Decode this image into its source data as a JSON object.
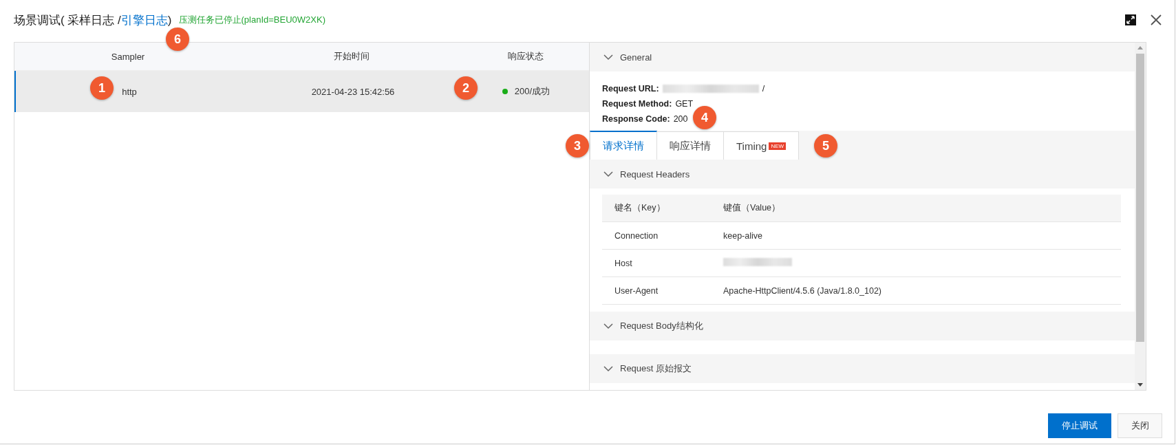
{
  "dialog": {
    "title_prefix": "场景调试( 采样日志 /",
    "title_link": "引擎日志",
    "title_suffix": ")",
    "status": "压测任务已停止(planId=BEU0W2XK)"
  },
  "samples": {
    "columns": [
      "Sampler",
      "开始时间",
      "响应状态"
    ],
    "rows": [
      {
        "sampler": "http",
        "start_time": "2021-04-23 15:42:56",
        "status": "200/成功",
        "color": "#1aad19",
        "selected": true
      }
    ]
  },
  "detail": {
    "general": {
      "title": "General",
      "expanded": true,
      "request_url_label": "Request URL:",
      "request_url_suffix": "/",
      "method_label": "Request Method:",
      "method": "GET",
      "code_label": "Response Code:",
      "code": "200"
    },
    "tabs": [
      {
        "label": "请求详情",
        "selected": true
      },
      {
        "label": "响应详情",
        "selected": false
      },
      {
        "label": "Timing",
        "badge": "NEW",
        "selected": false
      }
    ],
    "sections": [
      {
        "title": "Request Headers",
        "expanded": true,
        "columns": [
          "键名（Key）",
          "键值（Value）"
        ],
        "rows": [
          {
            "key": "Connection",
            "value": "keep-alive"
          },
          {
            "key": "Host",
            "redacted": true
          },
          {
            "key": "User-Agent",
            "value": "Apache-HttpClient/4.5.6 (Java/1.8.0_102)"
          }
        ]
      },
      {
        "title": "Request Body结构化",
        "expanded": true
      },
      {
        "title": "Request 原始报文",
        "expanded": true
      }
    ]
  },
  "buttons": [
    {
      "label": "停止调试",
      "kind": "primary"
    },
    {
      "label": "关闭",
      "kind": "normal"
    }
  ],
  "callouts": [
    "6",
    "1",
    "2",
    "3",
    "4",
    "5"
  ]
}
